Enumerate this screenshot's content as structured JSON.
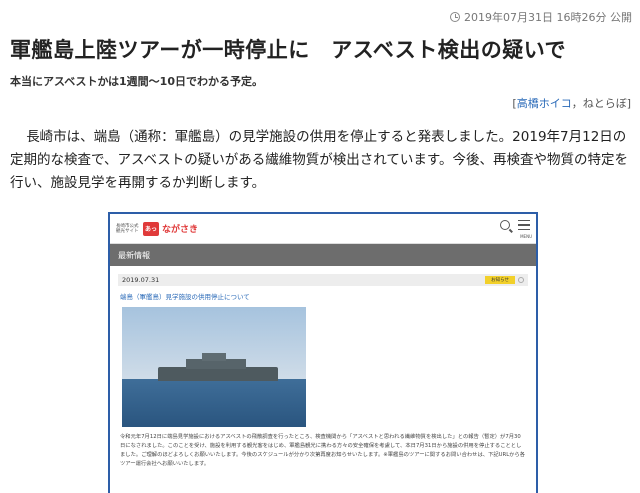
{
  "meta": {
    "timestamp": "2019年07月31日 16時26分 公開"
  },
  "article": {
    "headline": "軍艦島上陸ツアーが一時停止に　アスベスト検出の疑いで",
    "subhead": "本当にアスベストかは1週間〜10日でわかる予定。",
    "byline_open": "[",
    "author": "高橋ホイコ",
    "byline_rest": "，ねとらぼ]",
    "body": "長崎市は、端島（通称：軍艦島）の見学施設の供用を停止すると発表しました。2019年7月12日の定期的な検査で、アスベストの疑いがある繊維物質が検出されています。今後、再検査や物質の特定を行い、施設見学を再開するか判断します。"
  },
  "screenshot": {
    "site_small": "長崎市公式観光サイト",
    "logo_mark": "あっ",
    "logo_text": "ながさき",
    "menu_label": "MENU",
    "section": "最新情報",
    "news_date": "2019.07.31",
    "news_badge": "お知らせ",
    "news_title": "端島（軍艦島）見学施設の供用停止について",
    "news_body": "令和元年7月12日に端島見学施設におけるアスベストの飛散調査を行ったところ、検査機関から「アスベストと思われる繊維物質を検出した」との報告（暫定）が7月30日になされました。このことを受け、施設を利用する観光客をはじめ、軍艦島観光に携わる方々の安全確保を考慮して、本日7月31日から施設の供用を停止することとしました。ご理解のほどよろしくお願いいたします。今後のスケジュールが分かり次第再度お知らせいたします。※軍艦島のツアーに関するお問い合わせは、下記URLから各ツアー運行会社へお願いいたします。"
  }
}
